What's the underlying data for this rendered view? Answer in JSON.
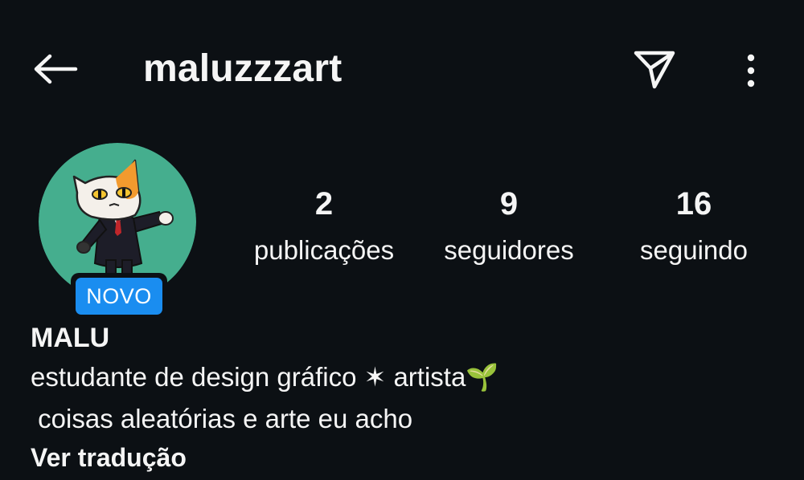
{
  "header": {
    "username": "maluzzzart",
    "back_icon": "back-arrow-icon",
    "send_icon": "paper-plane-icon",
    "more_icon": "more-vertical-icon"
  },
  "profile": {
    "avatar_icon": "cat-avatar-illustration",
    "new_badge": "NOVO",
    "badge_color": "#1a8df0",
    "stats": [
      {
        "value": "2",
        "label": "publicações"
      },
      {
        "value": "9",
        "label": "seguidores"
      },
      {
        "value": "16",
        "label": "seguindo"
      }
    ],
    "name": "MALU",
    "bio_lines": [
      "estudante de design gráfico ✶ artista🌱",
      " coisas aleatórias e arte eu acho"
    ],
    "translate_link": "Ver tradução"
  },
  "colors": {
    "background": "#0c1014",
    "text": "#f5f5f5",
    "avatar_bg": "#45ae8e"
  }
}
